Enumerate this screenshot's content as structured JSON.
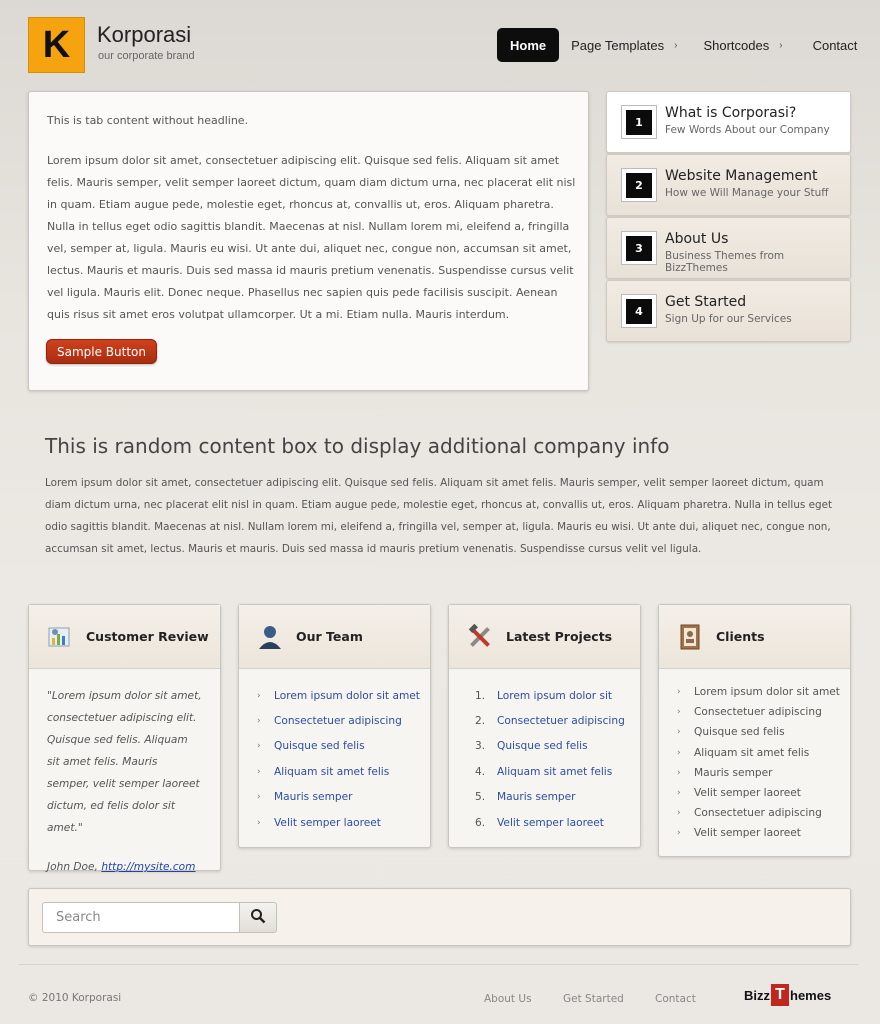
{
  "header": {
    "logo_letter": "K",
    "brand_title": "Korporasi",
    "brand_subtitle": "our corporate brand",
    "nav": [
      {
        "label": "Home",
        "active": true
      },
      {
        "label": "Page Templates",
        "arrow": "›"
      },
      {
        "label": "Shortcodes",
        "arrow": "›"
      },
      {
        "label": "Contact"
      }
    ]
  },
  "tab_panel": {
    "intro": "This is tab content without headline.",
    "paragraph": "Lorem ipsum dolor sit amet, consectetuer adipiscing elit. Quisque sed felis. Aliquam sit amet felis. Mauris semper, velit semper laoreet dictum, quam diam dictum urna, nec placerat elit nisl in quam. Etiam augue pede, molestie eget, rhoncus at, convallis ut, eros. Aliquam pharetra. Nulla in tellus eget odio sagittis blandit. Maecenas at nisl. Nullam lorem mi, eleifend a, fringilla vel, semper at, ligula. Mauris eu wisi. Ut ante dui, aliquet nec, congue non, accumsan sit amet, lectus. Mauris et mauris. Duis sed massa id mauris pretium venenatis. Suspendisse cursus velit vel ligula. Mauris elit. Donec neque. Phasellus nec sapien quis pede facilisis suscipit. Aenean quis risus sit amet eros volutpat ullamcorper. Ut a mi. Etiam nulla. Mauris interdum.",
    "button_label": "Sample Button"
  },
  "side_tabs": [
    {
      "num": "1",
      "title": "What is Corporasi?",
      "subtitle": "Few Words About our Company",
      "active": true
    },
    {
      "num": "2",
      "title": "Website Management",
      "subtitle": "How we Will Manage your Stuff"
    },
    {
      "num": "3",
      "title": "About Us",
      "subtitle": "Business Themes from BizzThemes"
    },
    {
      "num": "4",
      "title": "Get Started",
      "subtitle": "Sign Up for our Services"
    }
  ],
  "random_box": {
    "title": "This is random content box to display additional company info",
    "paragraph": "Lorem ipsum dolor sit amet, consectetuer adipiscing elit. Quisque sed felis. Aliquam sit amet felis. Mauris semper, velit semper laoreet dictum, quam diam dictum urna, nec placerat elit nisl in quam. Etiam augue pede, molestie eget, rhoncus at, convallis ut, eros. Aliquam pharetra. Nulla in tellus eget odio sagittis blandit. Maecenas at nisl. Nullam lorem mi, eleifend a, fringilla vel, semper at, ligula. Mauris eu wisi. Ut ante dui, aliquet nec, congue non, accumsan sit amet, lectus. Mauris et mauris. Duis sed massa id mauris pretium venenatis. Suspendisse cursus velit vel ligula."
  },
  "boxes": {
    "review": {
      "title": "Customer Review",
      "icon": "chart-icon",
      "quote": "\"Lorem ipsum dolor sit amet, consectetuer adipiscing elit. Quisque sed felis. Aliquam sit amet felis. Mauris semper, velit semper laoreet dictum, ed felis dolor sit amet.\"",
      "author": "John Doe,",
      "author_link": "http://mysite.com"
    },
    "team": {
      "title": "Our Team",
      "icon": "user-icon",
      "items": [
        "Lorem ipsum dolor sit amet",
        "Consectetuer adipiscing",
        "Quisque sed felis",
        "Aliquam sit amet felis",
        "Mauris semper",
        "Velit semper laoreet"
      ]
    },
    "projects": {
      "title": "Latest Projects",
      "icon": "tools-icon",
      "items": [
        "Lorem ipsum dolor sit",
        "Consectetuer adipiscing",
        "Quisque sed felis",
        "Aliquam sit amet felis",
        "Mauris semper",
        "Velit semper laoreet"
      ]
    },
    "clients": {
      "title": "Clients",
      "icon": "address-book-icon",
      "items": [
        "Lorem ipsum dolor sit amet",
        "Consectetuer adipiscing",
        "Quisque sed felis",
        "Aliquam sit amet felis",
        "Mauris semper",
        "Velit semper laoreet",
        "Consectetuer adipiscing",
        "Velit semper laoreet"
      ]
    }
  },
  "search": {
    "placeholder": "Search"
  },
  "footer": {
    "copyright": "© 2010 Korporasi",
    "links": [
      "About Us",
      "Get Started",
      "Contact"
    ],
    "logo_left": "Bizz",
    "logo_t": "T",
    "logo_right": "hemes"
  },
  "colors": {
    "accent_orange": "#f5a30f",
    "button_red": "#c0391a",
    "link_blue": "#2a4ea0",
    "nav_active": "#0d0d0d"
  }
}
